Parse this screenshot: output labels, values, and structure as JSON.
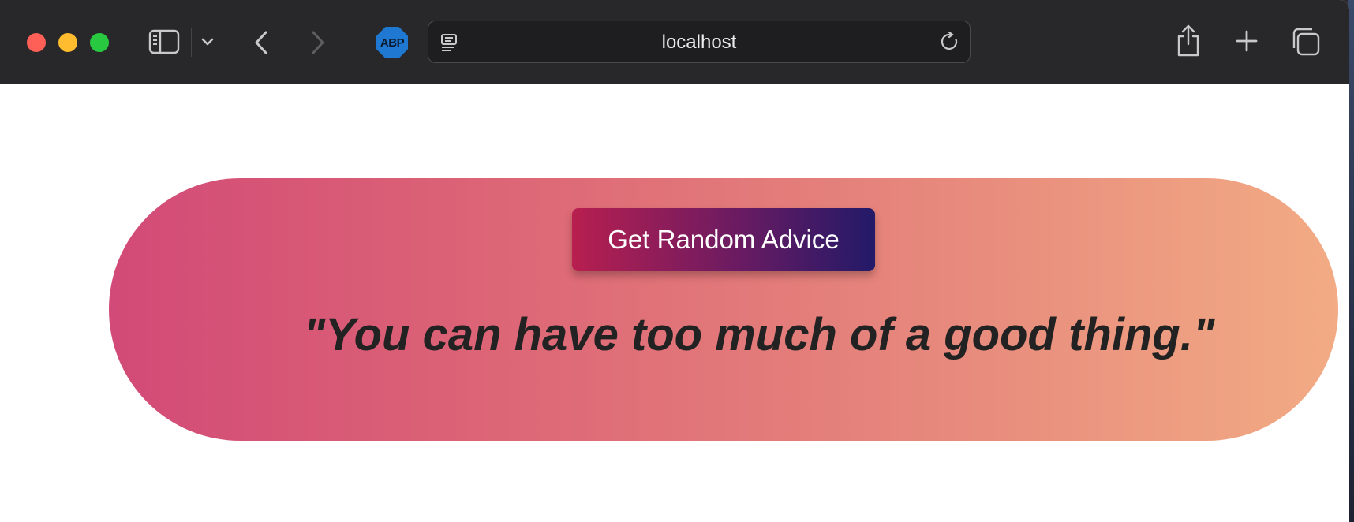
{
  "browser": {
    "url": "localhost",
    "extension_label": "ABP",
    "icons": {
      "sidebar": "sidebar-icon",
      "sidebar_menu": "chevron-down-icon",
      "back": "chevron-left-icon",
      "forward": "chevron-right-icon",
      "page": "page-menu-icon",
      "reload": "reload-icon",
      "share": "share-icon",
      "new_tab": "plus-icon",
      "tab_overview": "tabs-icon"
    }
  },
  "app": {
    "button_label": "Get Random Advice",
    "advice": "\"You can have too much of a good thing.\""
  },
  "colors": {
    "gradient_start": "#d24a77",
    "gradient_end": "#f2ab84",
    "button_start": "#b71f4f",
    "button_end": "#221a68",
    "close": "#fe5f57",
    "minimize": "#febc2e",
    "maximize": "#28c840"
  }
}
